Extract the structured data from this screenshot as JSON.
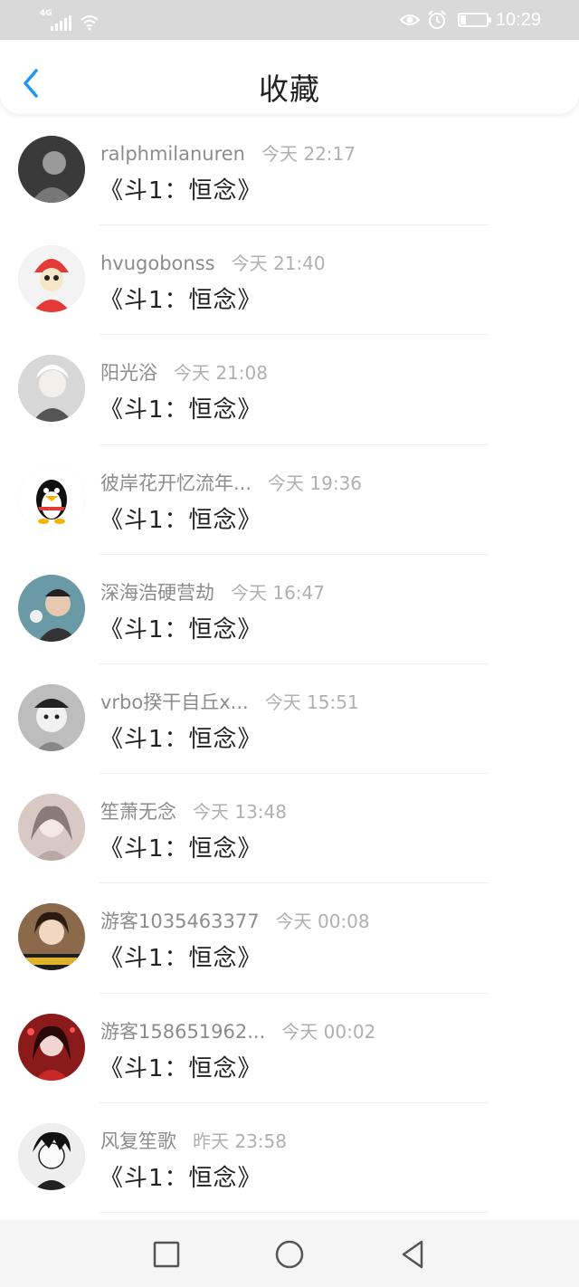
{
  "status_bar": {
    "network": "4G",
    "time": "10:29",
    "battery_level": 0.2
  },
  "header": {
    "title": "收藏",
    "back_icon": "chevron-left-icon",
    "accent": "#2196f3"
  },
  "items": [
    {
      "username": "ralphmilanuren",
      "time": "今天 22:17",
      "title": "《斗1：恒念》",
      "avatar_color": "#3a3a3a"
    },
    {
      "username": "hvugobonss",
      "time": "今天 21:40",
      "title": "《斗1：恒念》",
      "avatar_color": "#e53935"
    },
    {
      "username": "阳光浴",
      "time": "今天 21:08",
      "title": "《斗1：恒念》",
      "avatar_color": "#d7d7d7"
    },
    {
      "username": "彼岸花开忆流年...",
      "time": "今天 19:36",
      "title": "《斗1：恒念》",
      "avatar_color": "#ffffff"
    },
    {
      "username": "深海浩硬营劫",
      "time": "今天 16:47",
      "title": "《斗1：恒念》",
      "avatar_color": "#6a9aa6"
    },
    {
      "username": "vrbo揆干自丘x...",
      "time": "今天 15:51",
      "title": "《斗1：恒念》",
      "avatar_color": "#bdbdbd"
    },
    {
      "username": "笙萧无念",
      "time": "今天 13:48",
      "title": "《斗1：恒念》",
      "avatar_color": "#d9c9c5"
    },
    {
      "username": "游客1035463377",
      "time": "今天 00:08",
      "title": "《斗1：恒念》",
      "avatar_color": "#8a6a4a"
    },
    {
      "username": "游客158651962...",
      "time": "今天 00:02",
      "title": "《斗1：恒念》",
      "avatar_color": "#8b1a1a"
    },
    {
      "username": "风复笙歌",
      "time": "昨天 23:58",
      "title": "《斗1：恒念》",
      "avatar_color": "#eeeeee"
    }
  ],
  "nav_bar": {
    "icons": [
      "square-recents-icon",
      "circle-home-icon",
      "triangle-back-icon"
    ]
  }
}
